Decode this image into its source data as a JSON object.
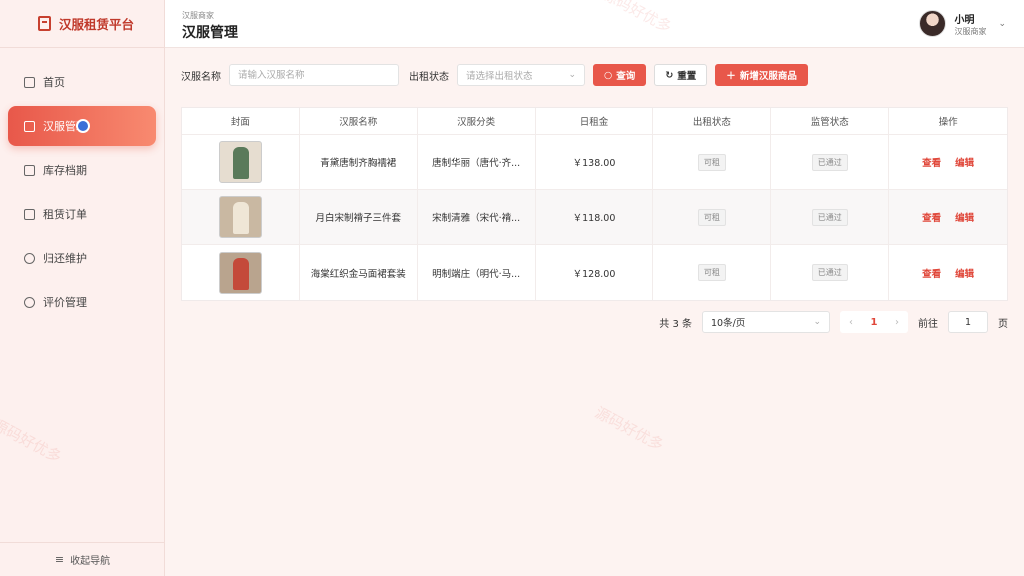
{
  "brand": {
    "title": "汉服租赁平台"
  },
  "sidebar": {
    "items": [
      {
        "label": "首页",
        "icon": "monitor-icon"
      },
      {
        "label": "汉服管理",
        "icon": "bag-icon"
      },
      {
        "label": "库存档期",
        "icon": "calendar-icon"
      },
      {
        "label": "租赁订单",
        "icon": "document-icon"
      },
      {
        "label": "归还维护",
        "icon": "refresh-icon"
      },
      {
        "label": "评价管理",
        "icon": "chat-icon"
      }
    ],
    "collapse_label": "收起导航"
  },
  "header": {
    "breadcrumb": "汉服商家",
    "title": "汉服管理",
    "user": {
      "name": "小明",
      "role": "汉服商家"
    }
  },
  "search": {
    "name_label": "汉服名称",
    "name_placeholder": "请输入汉服名称",
    "status_label": "出租状态",
    "status_placeholder": "请选择出租状态",
    "query_btn": "查询",
    "reset_btn": "重置",
    "add_btn": "新增汉服商品"
  },
  "table": {
    "headers": [
      "封面",
      "汉服名称",
      "汉服分类",
      "日租金",
      "出租状态",
      "监管状态",
      "操作"
    ],
    "rows": [
      {
        "name": "青黛唐制齐胸襦裙",
        "category": "唐制华丽（唐代·齐...",
        "price": "￥138.00",
        "rent_status": "可租",
        "audit_status": "已通过",
        "view": "查看",
        "edit": "编辑",
        "color": "#5a7a5a"
      },
      {
        "name": "月白宋制褙子三件套",
        "category": "宋制清雅（宋代·褙...",
        "price": "￥118.00",
        "rent_status": "可租",
        "audit_status": "已通过",
        "view": "查看",
        "edit": "编辑",
        "color": "#d9cbb2"
      },
      {
        "name": "海棠红织金马面裙套装",
        "category": "明制端庄（明代·马...",
        "price": "￥128.00",
        "rent_status": "可租",
        "audit_status": "已通过",
        "view": "查看",
        "edit": "编辑",
        "color": "#c44a3a"
      }
    ]
  },
  "pager": {
    "total": "共 3 条",
    "page_size": "10条/页",
    "current": "1",
    "goto_label": "前往",
    "goto_value": "1",
    "page_suffix": "页"
  },
  "watermark": "源码好优多",
  "colors": {
    "accent": "#e8574a",
    "brand": "#c0392b"
  }
}
